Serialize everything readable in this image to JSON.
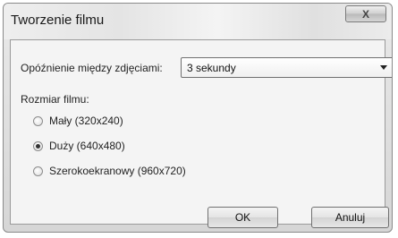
{
  "window": {
    "title": "Tworzenie filmu",
    "close_symbol": "X"
  },
  "delay": {
    "label": "Opóźnienie między zdjęciami:",
    "selected": "3 sekundy"
  },
  "size": {
    "label": "Rozmiar filmu:",
    "options": [
      {
        "label": "Mały (320x240)",
        "checked": false
      },
      {
        "label": "Duży (640x480)",
        "checked": true
      },
      {
        "label": "Szerokoekranowy (960x720)",
        "checked": false
      }
    ]
  },
  "buttons": {
    "ok": "OK",
    "cancel": "Anuluj"
  },
  "icons": {
    "close": "close-icon",
    "dropdown": "chevron-down-icon"
  }
}
